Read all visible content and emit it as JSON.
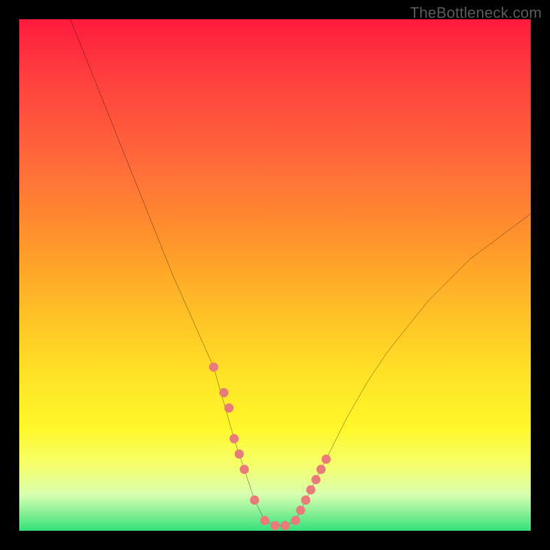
{
  "watermark": "TheBottleneck.com",
  "chart_data": {
    "type": "line",
    "title": "",
    "xlabel": "",
    "ylabel": "",
    "xlim": [
      0,
      100
    ],
    "ylim": [
      0,
      100
    ],
    "series": [
      {
        "name": "bottleneck-curve",
        "x": [
          10,
          14,
          18,
          22,
          26,
          30,
          34,
          38,
          42,
          44,
          46,
          48,
          50,
          52,
          54,
          56,
          60,
          64,
          68,
          72,
          76,
          80,
          84,
          88,
          92,
          96,
          100
        ],
        "y": [
          100,
          90,
          80,
          70,
          60,
          50,
          41,
          32,
          18,
          12,
          6,
          2,
          1,
          1,
          2,
          6,
          14,
          22,
          29,
          35,
          40,
          45,
          49,
          53,
          56,
          59,
          62
        ]
      }
    ],
    "markers": {
      "name": "highlight-points",
      "color": "#e97b7b",
      "x": [
        38,
        40,
        41,
        42,
        43,
        44,
        46,
        48,
        50,
        52,
        54,
        55,
        56,
        57,
        58,
        59,
        60
      ],
      "y": [
        32,
        27,
        24,
        18,
        15,
        12,
        6,
        2,
        1,
        1,
        2,
        4,
        6,
        8,
        10,
        12,
        14
      ]
    }
  }
}
